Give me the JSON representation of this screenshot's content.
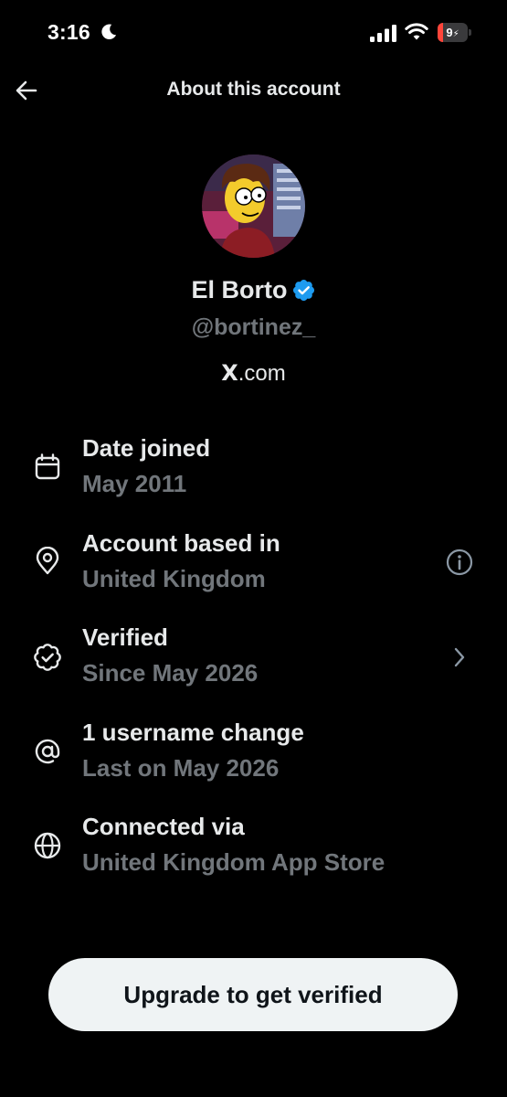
{
  "status_bar": {
    "time": "3:16",
    "battery_text": "9",
    "battery_level": 0.09,
    "battery_color": "#ff453a",
    "icons": [
      "moon-icon",
      "signal-icon",
      "wifi-icon",
      "battery-icon"
    ]
  },
  "header": {
    "title": "About this account",
    "back_icon": "arrow-left-icon"
  },
  "profile": {
    "display_name": "El Borto",
    "username": "@bortinez_",
    "site_suffix": ".com",
    "site_logo_letter": "X",
    "verified_color": "#1d9bf0"
  },
  "info_rows": [
    {
      "icon": "calendar-icon",
      "label": "Date joined",
      "value": "May 2011",
      "action": null
    },
    {
      "icon": "location-pin-icon",
      "label": "Account based in",
      "value": "United Kingdom",
      "action": "info-icon"
    },
    {
      "icon": "verified-seal-icon",
      "label": "Verified",
      "value": "Since May 2026",
      "action": "chevron-right-icon"
    },
    {
      "icon": "at-sign-icon",
      "label": "1 username change",
      "value": "Last on May 2026",
      "action": null
    },
    {
      "icon": "globe-icon",
      "label": "Connected via",
      "value": "United Kingdom App Store",
      "action": null
    }
  ],
  "footer": {
    "button_label": "Upgrade to get verified"
  },
  "colors": {
    "background": "#000000",
    "primary_text": "#e7e9ea",
    "secondary_text": "#71767b",
    "button_bg": "#eff3f4",
    "button_text": "#0f1419"
  }
}
